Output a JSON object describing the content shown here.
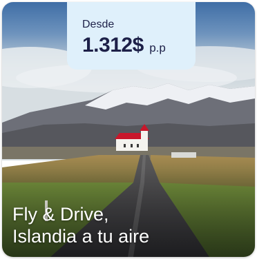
{
  "card": {
    "price": {
      "from_label": "Desde",
      "amount": "1.312$",
      "unit": "p.p"
    },
    "title_line1": "Fly & Drive,",
    "title_line2": "Islandia a tu aire",
    "colors": {
      "badge_bg": "#dff0fb",
      "badge_text": "#1d2048",
      "title_text": "#ffffff"
    }
  }
}
